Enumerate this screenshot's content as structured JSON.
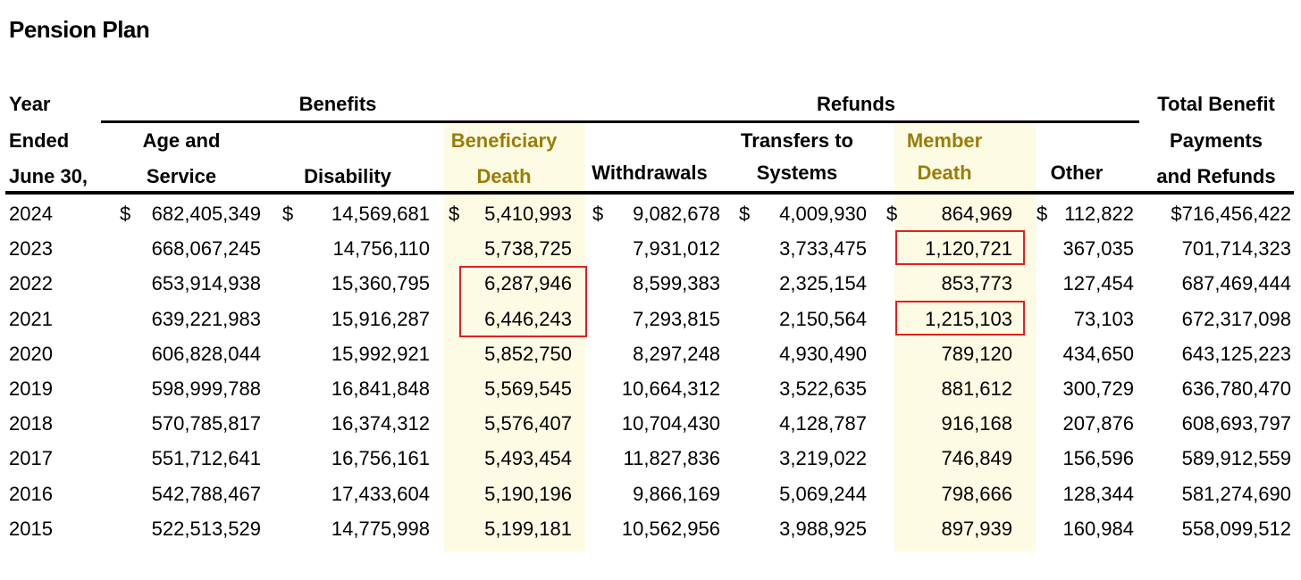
{
  "title": "Pension Plan",
  "headers": {
    "year": [
      "Year",
      "Ended",
      "June 30,"
    ],
    "benefits_group": "Benefits",
    "refunds_group": "Refunds",
    "age_service": [
      "Age and",
      "Service"
    ],
    "disability": "Disability",
    "beneficiary_death": [
      "Beneficiary",
      "Death"
    ],
    "withdrawals": "Withdrawals",
    "transfers": [
      "Transfers to",
      "Systems"
    ],
    "member_death": [
      "Member",
      "Death"
    ],
    "other": "Other",
    "total": [
      "Total Benefit",
      "Payments",
      "and Refunds"
    ]
  },
  "currency_symbol": "$",
  "highlight_color": "#fdfbe3",
  "highlight_text_color": "#9a7c0a",
  "box_color": "#e0201f",
  "rows": [
    {
      "year": "2024",
      "age_service": "682,405,349",
      "disability": "14,569,681",
      "beneficiary_death": "5,410,993",
      "withdrawals": "9,082,678",
      "transfers": "4,009,930",
      "member_death": "864,969",
      "other": "112,822",
      "total": "$716,456,422"
    },
    {
      "year": "2023",
      "age_service": "668,067,245",
      "disability": "14,756,110",
      "beneficiary_death": "5,738,725",
      "withdrawals": "7,931,012",
      "transfers": "3,733,475",
      "member_death": "1,120,721",
      "other": "367,035",
      "total": "701,714,323"
    },
    {
      "year": "2022",
      "age_service": "653,914,938",
      "disability": "15,360,795",
      "beneficiary_death": "6,287,946",
      "withdrawals": "8,599,383",
      "transfers": "2,325,154",
      "member_death": "853,773",
      "other": "127,454",
      "total": "687,469,444"
    },
    {
      "year": "2021",
      "age_service": "639,221,983",
      "disability": "15,916,287",
      "beneficiary_death": "6,446,243",
      "withdrawals": "7,293,815",
      "transfers": "2,150,564",
      "member_death": "1,215,103",
      "other": "73,103",
      "total": "672,317,098"
    },
    {
      "year": "2020",
      "age_service": "606,828,044",
      "disability": "15,992,921",
      "beneficiary_death": "5,852,750",
      "withdrawals": "8,297,248",
      "transfers": "4,930,490",
      "member_death": "789,120",
      "other": "434,650",
      "total": "643,125,223"
    },
    {
      "year": "2019",
      "age_service": "598,999,788",
      "disability": "16,841,848",
      "beneficiary_death": "5,569,545",
      "withdrawals": "10,664,312",
      "transfers": "3,522,635",
      "member_death": "881,612",
      "other": "300,729",
      "total": "636,780,470"
    },
    {
      "year": "2018",
      "age_service": "570,785,817",
      "disability": "16,374,312",
      "beneficiary_death": "5,576,407",
      "withdrawals": "10,704,430",
      "transfers": "4,128,787",
      "member_death": "916,168",
      "other": "207,876",
      "total": "608,693,797"
    },
    {
      "year": "2017",
      "age_service": "551,712,641",
      "disability": "16,756,161",
      "beneficiary_death": "5,493,454",
      "withdrawals": "11,827,836",
      "transfers": "3,219,022",
      "member_death": "746,849",
      "other": "156,596",
      "total": "589,912,559"
    },
    {
      "year": "2016",
      "age_service": "542,788,467",
      "disability": "17,433,604",
      "beneficiary_death": "5,190,196",
      "withdrawals": "9,866,169",
      "transfers": "5,069,244",
      "member_death": "798,666",
      "other": "128,344",
      "total": "581,274,690"
    },
    {
      "year": "2015",
      "age_service": "522,513,529",
      "disability": "14,775,998",
      "beneficiary_death": "5,199,181",
      "withdrawals": "10,562,956",
      "transfers": "3,988,925",
      "member_death": "897,939",
      "other": "160,984",
      "total": "558,099,512"
    }
  ]
}
